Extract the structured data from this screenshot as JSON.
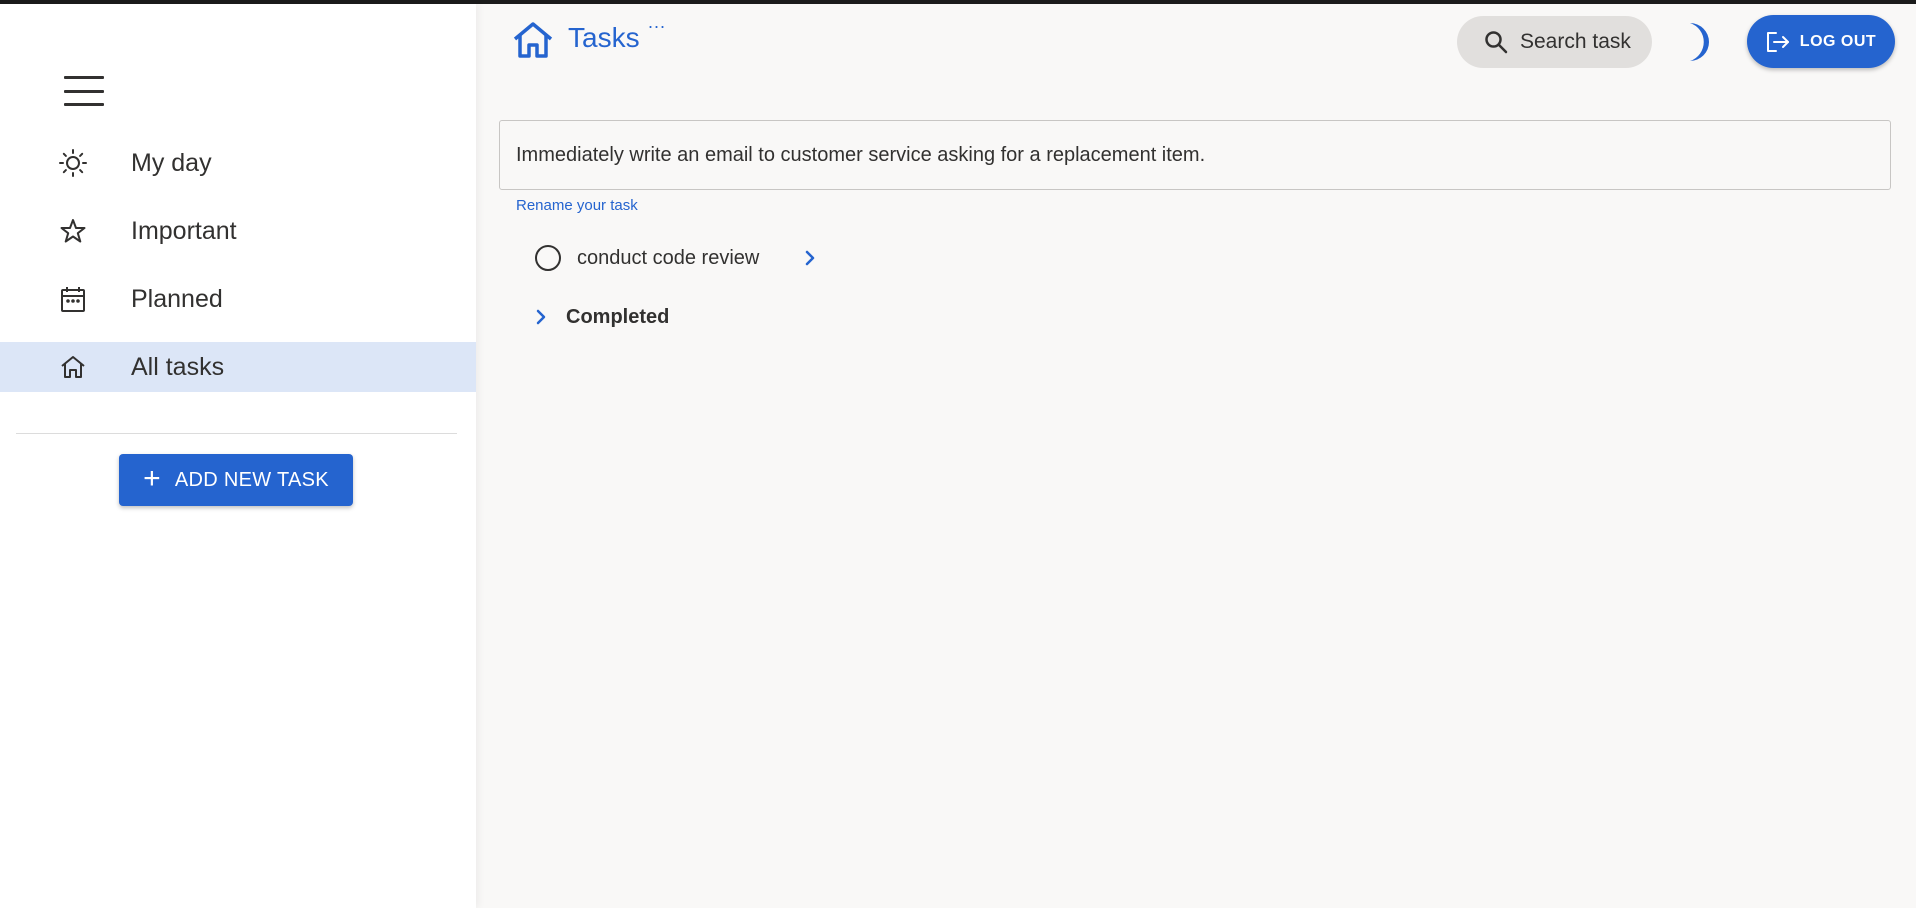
{
  "header": {
    "title": "Tasks",
    "more_label": "...",
    "search_label": "Search task",
    "logout_label": "LOG OUT"
  },
  "sidebar": {
    "items": [
      {
        "label": "My day",
        "icon": "sun-icon",
        "active": false
      },
      {
        "label": "Important",
        "icon": "star-icon",
        "active": false
      },
      {
        "label": "Planned",
        "icon": "calendar-icon",
        "active": false
      },
      {
        "label": "All tasks",
        "icon": "home-icon",
        "active": true
      }
    ],
    "add_button_label": "ADD NEW TASK"
  },
  "main": {
    "task_input_value": "Immediately write an email to customer service asking for a replacement item.",
    "helper_text": "Rename your task",
    "tasks": [
      {
        "title": "conduct code review"
      }
    ],
    "completed_label": "Completed"
  },
  "colors": {
    "accent": "#2564cf",
    "active_nav": "#dce6f7",
    "background": "#f9f8f7",
    "search_bg": "#e1dfdd"
  }
}
